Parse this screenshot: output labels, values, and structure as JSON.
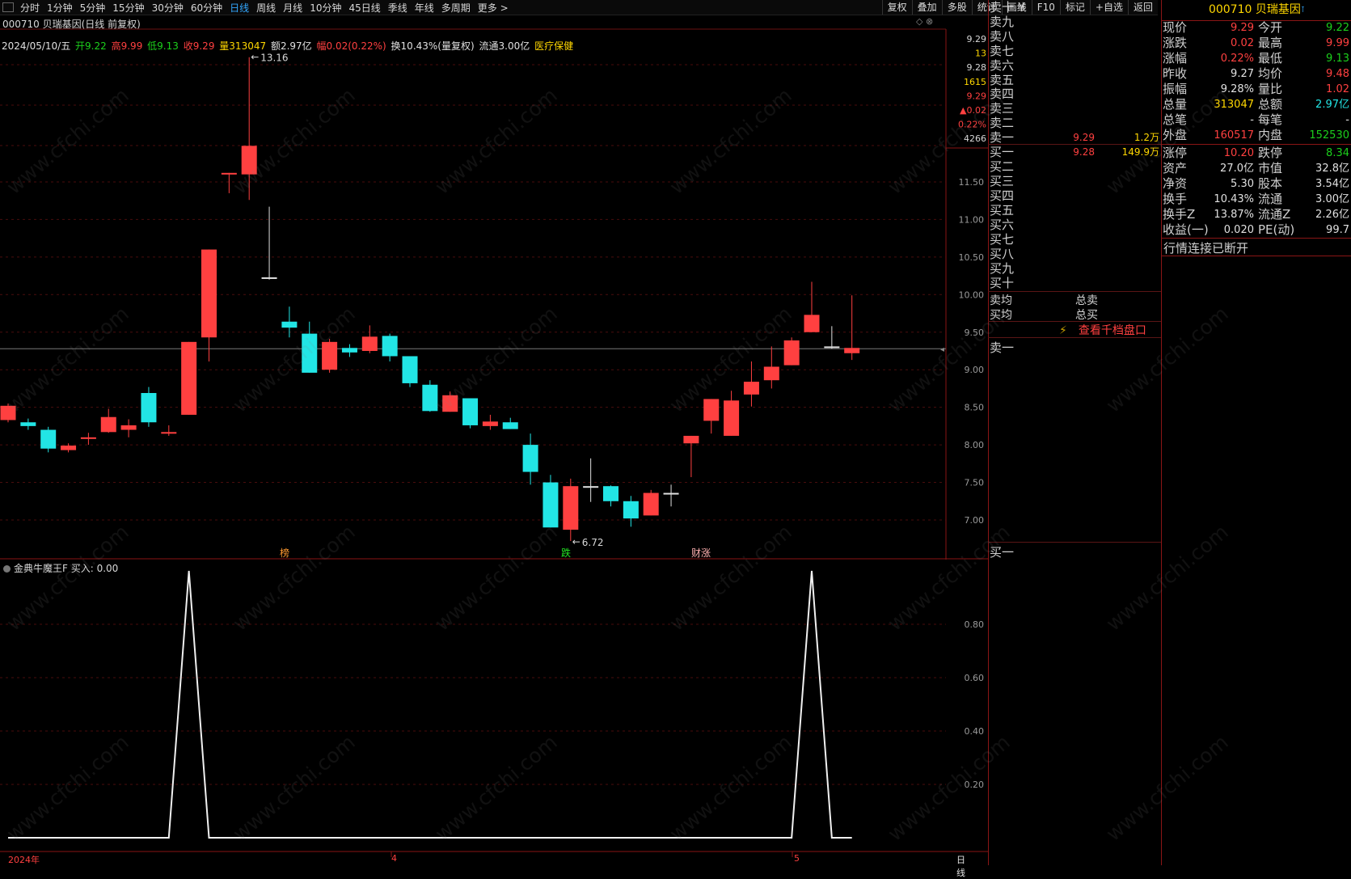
{
  "toolbar": {
    "periods": [
      "分时",
      "1分钟",
      "5分钟",
      "15分钟",
      "30分钟",
      "60分钟",
      "日线",
      "周线",
      "月线",
      "10分钟",
      "45日线",
      "季线",
      "年线",
      "多周期",
      "更多 >"
    ],
    "active_period": "日线",
    "tools": [
      "复权",
      "叠加",
      "多股",
      "统计",
      "画线",
      "F10",
      "标记",
      "+自选",
      "返回"
    ]
  },
  "chart": {
    "title": "000710 贝瑞基因(日线 前复权)",
    "info": {
      "date": "2024/05/10/五",
      "open": "开9.22",
      "high": "高9.99",
      "low": "低9.13",
      "close": "收9.29",
      "volume": "量313047",
      "amount": "额2.97亿",
      "change": "幅0.02(0.22%)",
      "turnover": "换10.43%(量复权)",
      "float": "流通3.00亿",
      "sector": "医疗保健"
    },
    "right_axis_top": [
      {
        "text": "9.29",
        "color": "#d8d8d8"
      },
      {
        "text": "13",
        "color": "#ffd700"
      },
      {
        "text": "9.28",
        "color": "#d8d8d8"
      },
      {
        "text": "1615",
        "color": "#ffd700"
      },
      {
        "text": "9.29",
        "color": "#ff4040"
      },
      {
        "text": "▲0.02",
        "color": "#ff4040"
      },
      {
        "text": "0.22%",
        "color": "#ff4040"
      },
      {
        "text": "4266",
        "color": "#d8d8d8"
      }
    ],
    "price_ticks": [
      "11.50",
      "11.00",
      "10.50",
      "10.00",
      "9.50",
      "9.00",
      "8.50",
      "8.00",
      "7.50",
      "7.00"
    ],
    "high_label": "13.16",
    "low_label": "6.72",
    "markers": [
      {
        "text": "榜",
        "color": "#ff9a30"
      },
      {
        "text": "跌",
        "color": "#22e522"
      },
      {
        "text": "财涨",
        "color": "#ffb0b0"
      }
    ],
    "candles": [
      [
        8.33,
        8.52,
        8.55,
        8.3
      ],
      [
        8.3,
        8.25,
        8.35,
        8.2
      ],
      [
        8.2,
        7.95,
        8.24,
        7.9
      ],
      [
        7.93,
        7.99,
        8.02,
        7.9
      ],
      [
        8.08,
        8.1,
        8.16,
        8.0
      ],
      [
        8.17,
        8.37,
        8.48,
        8.16
      ],
      [
        8.2,
        8.26,
        8.34,
        8.1
      ],
      [
        8.69,
        8.3,
        8.77,
        8.24
      ],
      [
        8.15,
        8.17,
        8.26,
        8.12
      ],
      [
        8.4,
        9.37,
        9.37,
        8.4
      ],
      [
        9.43,
        10.6,
        10.6,
        9.11
      ],
      [
        11.6,
        11.62,
        11.62,
        11.35
      ],
      [
        11.6,
        11.98,
        13.16,
        11.26
      ],
      [
        10.23,
        10.23,
        11.17,
        10.2
      ],
      [
        9.64,
        9.56,
        9.84,
        9.43
      ],
      [
        9.48,
        8.96,
        9.64,
        8.96
      ],
      [
        9.0,
        9.37,
        9.41,
        8.96
      ],
      [
        9.29,
        9.23,
        9.34,
        9.17
      ],
      [
        9.25,
        9.44,
        9.59,
        9.22
      ],
      [
        9.45,
        9.18,
        9.48,
        9.11
      ],
      [
        9.18,
        8.82,
        9.18,
        8.77
      ],
      [
        8.8,
        8.45,
        8.86,
        8.44
      ],
      [
        8.44,
        8.66,
        8.71,
        8.44
      ],
      [
        8.62,
        8.26,
        8.62,
        8.22
      ],
      [
        8.25,
        8.31,
        8.4,
        8.2
      ],
      [
        8.3,
        8.21,
        8.36,
        8.21
      ],
      [
        8.0,
        7.64,
        8.15,
        7.47
      ],
      [
        7.5,
        6.9,
        7.6,
        6.9
      ],
      [
        6.87,
        7.45,
        7.55,
        6.72
      ],
      [
        7.45,
        7.45,
        7.82,
        7.24
      ],
      [
        7.45,
        7.25,
        7.46,
        7.18
      ],
      [
        7.25,
        7.02,
        7.32,
        6.91
      ],
      [
        7.06,
        7.36,
        7.4,
        7.06
      ],
      [
        7.36,
        7.36,
        7.47,
        7.18
      ],
      [
        8.02,
        8.12,
        8.12,
        7.57
      ],
      [
        8.32,
        8.61,
        8.61,
        8.15
      ],
      [
        8.12,
        8.59,
        8.72,
        8.12
      ],
      [
        8.67,
        8.84,
        9.11,
        8.51
      ],
      [
        8.86,
        9.04,
        9.31,
        8.75
      ],
      [
        9.06,
        9.39,
        9.43,
        9.06
      ],
      [
        9.5,
        9.73,
        10.17,
        9.5
      ],
      [
        9.31,
        9.31,
        9.58,
        9.28
      ],
      [
        9.22,
        9.29,
        9.99,
        9.13
      ]
    ]
  },
  "indicator": {
    "title": "金典牛魔王F  买入: 0.00",
    "ticks": [
      "0.80",
      "0.60",
      "0.40",
      "0.20"
    ],
    "values": [
      0,
      0,
      0,
      0,
      0,
      0,
      0,
      0,
      0,
      1,
      0,
      0,
      0,
      0,
      0,
      0,
      0,
      0,
      0,
      0,
      0,
      0,
      0,
      0,
      0,
      0,
      0,
      0,
      0,
      0,
      0,
      0,
      0,
      0,
      0,
      0,
      0,
      0,
      0,
      0,
      1,
      0,
      0
    ],
    "x_labels": [
      "2024年",
      "4",
      "5"
    ],
    "period_label": "日线"
  },
  "orderbook": {
    "sells": [
      {
        "label": "卖十 ¥",
        "price": "",
        "volume": ""
      },
      {
        "label": "卖九",
        "price": "",
        "volume": ""
      },
      {
        "label": "卖八",
        "price": "",
        "volume": ""
      },
      {
        "label": "卖七",
        "price": "",
        "volume": ""
      },
      {
        "label": "卖六",
        "price": "",
        "volume": ""
      },
      {
        "label": "卖五",
        "price": "",
        "volume": ""
      },
      {
        "label": "卖四",
        "price": "",
        "volume": ""
      },
      {
        "label": "卖三",
        "price": "",
        "volume": ""
      },
      {
        "label": "卖二",
        "price": "",
        "volume": ""
      },
      {
        "label": "卖一",
        "price": "9.29",
        "volume": "1.2万"
      }
    ],
    "buys": [
      {
        "label": "买一",
        "price": "9.28",
        "volume": "149.9万"
      },
      {
        "label": "买二",
        "price": "",
        "volume": ""
      },
      {
        "label": "买三",
        "price": "",
        "volume": ""
      },
      {
        "label": "买四",
        "price": "",
        "volume": ""
      },
      {
        "label": "买五",
        "price": "",
        "volume": ""
      },
      {
        "label": "买六",
        "price": "",
        "volume": ""
      },
      {
        "label": "买七",
        "price": "",
        "volume": ""
      },
      {
        "label": "买八",
        "price": "",
        "volume": ""
      },
      {
        "label": "买九",
        "price": "",
        "volume": ""
      },
      {
        "label": "买十",
        "price": "",
        "volume": ""
      }
    ],
    "sell_avg": "卖均",
    "total_sell": "总卖",
    "buy_avg": "买均",
    "total_buy": "总买",
    "depth_button": "查看千档盘口",
    "queue_sell": "卖一",
    "queue_buy": "买一"
  },
  "quote": {
    "header": "000710 贝瑞基因",
    "rows": [
      {
        "l1": "现价",
        "v1": "9.29",
        "c1": "red",
        "l2": "今开",
        "v2": "9.22",
        "c2": "green"
      },
      {
        "l1": "涨跌",
        "v1": "0.02",
        "c1": "red",
        "l2": "最高",
        "v2": "9.99",
        "c2": "red"
      },
      {
        "l1": "涨幅",
        "v1": "0.22%",
        "c1": "red",
        "l2": "最低",
        "v2": "9.13",
        "c2": "green"
      },
      {
        "l1": "昨收",
        "v1": "9.27",
        "c1": "white",
        "l2": "均价",
        "v2": "9.48",
        "c2": "red"
      },
      {
        "l1": "振幅",
        "v1": "9.28%",
        "c1": "white",
        "l2": "量比",
        "v2": "1.02",
        "c2": "red"
      },
      {
        "l1": "总量",
        "v1": "313047",
        "c1": "yellow",
        "l2": "总额",
        "v2": "2.97亿",
        "c2": "cyan"
      },
      {
        "l1": "总笔",
        "v1": "-",
        "c1": "white",
        "l2": "每笔",
        "v2": "-",
        "c2": "white"
      },
      {
        "l1": "外盘",
        "v1": "160517",
        "c1": "red",
        "l2": "内盘",
        "v2": "152530",
        "c2": "green"
      },
      {
        "l1": "涨停",
        "v1": "10.20",
        "c1": "red",
        "l2": "跌停",
        "v2": "8.34",
        "c2": "green"
      },
      {
        "l1": "资产",
        "v1": "27.0亿",
        "c1": "white",
        "l2": "市值",
        "v2": "32.8亿",
        "c2": "white"
      },
      {
        "l1": "净资",
        "v1": "5.30",
        "c1": "white",
        "l2": "股本",
        "v2": "3.54亿",
        "c2": "white"
      },
      {
        "l1": "换手",
        "v1": "10.43%",
        "c1": "white",
        "l2": "流通",
        "v2": "3.00亿",
        "c2": "white"
      },
      {
        "l1": "换手Z",
        "v1": "13.87%",
        "c1": "white",
        "l2": "流通Z",
        "v2": "2.26亿",
        "c2": "white"
      },
      {
        "l1": "收益(一)",
        "v1": "0.020",
        "c1": "white",
        "l2": "PE(动)",
        "v2": "99.7",
        "c2": "white"
      }
    ],
    "status": "行情连接已断开"
  },
  "colors": {
    "up": "#ff4040",
    "down": "#22e5e5",
    "grid": "#4a0d0d",
    "border": "#8a1515"
  },
  "watermark": "www.cfchi.com"
}
